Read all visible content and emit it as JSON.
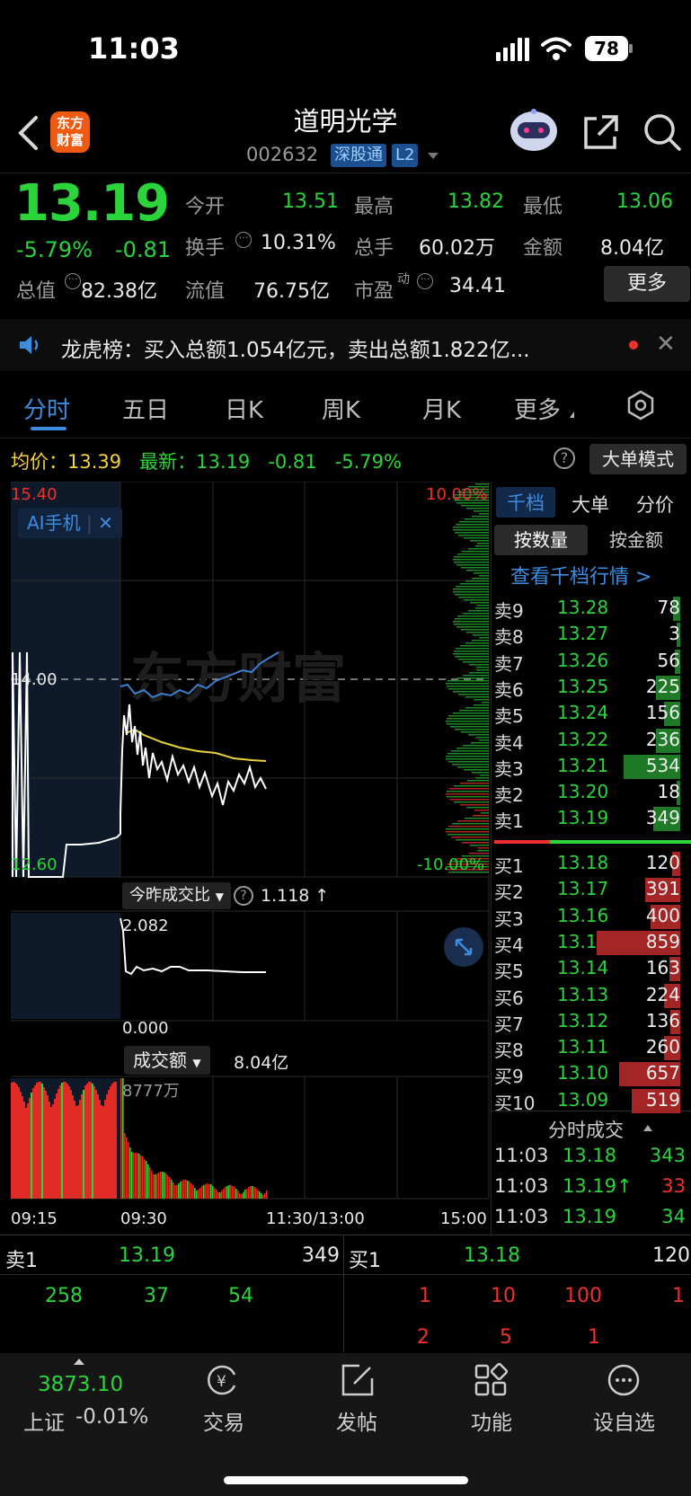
{
  "status": {
    "time": "11:03",
    "battery": "78"
  },
  "header": {
    "logo_text_1": "东方",
    "logo_text_2": "财富",
    "stock_name": "道明光学",
    "stock_code": "002632",
    "tag_1": "深股通",
    "tag_2": "L2"
  },
  "quote": {
    "price": "13.19",
    "change_pct": "-5.79%",
    "change": "-0.81",
    "open_label": "今开",
    "open": "13.51",
    "high_label": "最高",
    "high": "13.82",
    "low_label": "最低",
    "low": "13.06",
    "turnover_label": "换手",
    "turnover": "10.31%",
    "volume_label": "总手",
    "volume": "60.02万",
    "amount_label": "金额",
    "amount": "8.04亿",
    "mcap_label": "总值",
    "mcap": "82.38亿",
    "float_label": "流值",
    "float": "76.75亿",
    "pe_label": "市盈",
    "pe_sup": "动",
    "pe": "34.41",
    "more_label": "更多"
  },
  "news": {
    "text": "龙虎榜：买入总额1.054亿元，卖出总额1.822亿..."
  },
  "tabs": [
    "分时",
    "五日",
    "日K",
    "周K",
    "月K",
    "更多"
  ],
  "info_line": {
    "avg_label": "均价：",
    "avg": "13.39",
    "latest_label": "最新：",
    "latest": "13.19",
    "change": "-0.81",
    "change_pct": "-5.79%",
    "mode_label": "大单模式"
  },
  "chart": {
    "y_top": "15.40",
    "y_mid": "14.00",
    "y_bot": "12.60",
    "pct_top": "10.00%",
    "pct_bot": "-10.00%",
    "ai_label": "AI手机",
    "ratio_label": "今昨成交比",
    "ratio_value": "1.118 ↑",
    "ratio_top": "2.082",
    "ratio_bot": "0.000",
    "vol_label": "成交额",
    "vol_value": "8.04亿",
    "vol_max": "8777万",
    "x_labels": [
      "09:15",
      "09:30",
      "11:30/13:00",
      "15:00"
    ],
    "watermark": "东方财富"
  },
  "orderbook": {
    "tabs": [
      "千档",
      "大单",
      "分价"
    ],
    "subtabs": [
      "按数量",
      "按金额"
    ],
    "link": "查看千档行情 >",
    "sells": [
      {
        "label": "卖9",
        "price": "13.28",
        "vol": "78",
        "fill": 0.05
      },
      {
        "label": "卖8",
        "price": "13.27",
        "vol": "3",
        "fill": 0.01
      },
      {
        "label": "卖7",
        "price": "13.26",
        "vol": "56",
        "fill": 0.04
      },
      {
        "label": "卖6",
        "price": "13.25",
        "vol": "225",
        "fill": 0.18
      },
      {
        "label": "卖5",
        "price": "13.24",
        "vol": "156",
        "fill": 0.12
      },
      {
        "label": "卖4",
        "price": "13.22",
        "vol": "236",
        "fill": 0.18
      },
      {
        "label": "卖3",
        "price": "13.21",
        "vol": "534",
        "fill": 0.42
      },
      {
        "label": "卖2",
        "price": "13.20",
        "vol": "18",
        "fill": 0.02
      },
      {
        "label": "卖1",
        "price": "13.19",
        "vol": "349",
        "fill": 0.2
      }
    ],
    "buys": [
      {
        "label": "买1",
        "price": "13.18",
        "vol": "120",
        "fill": 0.06
      },
      {
        "label": "买2",
        "price": "13.17",
        "vol": "391",
        "fill": 0.26
      },
      {
        "label": "买3",
        "price": "13.16",
        "vol": "400",
        "fill": 0.22
      },
      {
        "label": "买4",
        "price": "13.15",
        "vol": "859",
        "fill": 0.62
      },
      {
        "label": "买5",
        "price": "13.14",
        "vol": "163",
        "fill": 0.08
      },
      {
        "label": "买6",
        "price": "13.13",
        "vol": "224",
        "fill": 0.12
      },
      {
        "label": "买7",
        "price": "13.12",
        "vol": "136",
        "fill": 0.07
      },
      {
        "label": "买8",
        "price": "13.11",
        "vol": "260",
        "fill": 0.12
      },
      {
        "label": "买9",
        "price": "13.10",
        "vol": "657",
        "fill": 0.45
      },
      {
        "label": "买10",
        "price": "13.09",
        "vol": "519",
        "fill": 0.36
      }
    ],
    "ticks_title": "分时成交",
    "ticks": [
      {
        "time": "11:03",
        "price": "13.18",
        "vol": "343"
      },
      {
        "time": "11:03",
        "price": "13.19↑",
        "vol": "33"
      },
      {
        "time": "11:03",
        "price": "13.19",
        "vol": "34"
      }
    ]
  },
  "bottom_book": {
    "sell_label": "卖1",
    "sell_price": "13.19",
    "sell_vol": "349",
    "buy_label": "买1",
    "buy_price": "13.18",
    "buy_vol": "120",
    "sell_queue": [
      "258",
      "37",
      "54"
    ],
    "buy_queue_1": [
      "1",
      "10",
      "100",
      "1"
    ],
    "buy_queue_2": [
      "2",
      "5",
      "1"
    ]
  },
  "bottom_nav": {
    "index_value": "3873.10",
    "index_name": "上证",
    "index_change": "-0.01%",
    "items": [
      "交易",
      "发帖",
      "功能",
      "设自选"
    ]
  },
  "colors": {
    "up": "#f0302c",
    "down": "#2bd43a",
    "accent": "#3d8ce0",
    "avg": "#f5d33b"
  }
}
